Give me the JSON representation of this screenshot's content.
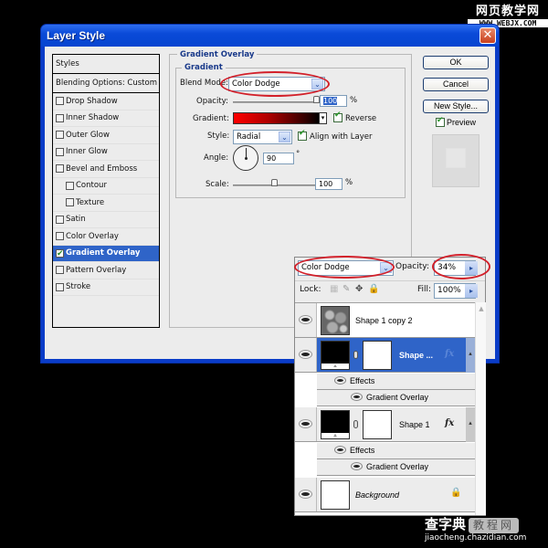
{
  "watermark_top": {
    "cn": "网页教学网",
    "en": "WWW.WEBJX.COM"
  },
  "watermark_bottom": {
    "cn": "查字典",
    "cn_box": "教程网",
    "en": "jiaocheng.chazidian.com"
  },
  "dialog": {
    "title": "Layer Style",
    "close_label": "✕",
    "styles_list": {
      "header": "Styles",
      "blending": "Blending Options: Custom",
      "items": [
        {
          "label": "Drop Shadow",
          "checked": false,
          "indent": false,
          "active": false
        },
        {
          "label": "Inner Shadow",
          "checked": false,
          "indent": false,
          "active": false
        },
        {
          "label": "Outer Glow",
          "checked": false,
          "indent": false,
          "active": false
        },
        {
          "label": "Inner Glow",
          "checked": false,
          "indent": false,
          "active": false
        },
        {
          "label": "Bevel and Emboss",
          "checked": false,
          "indent": false,
          "active": false
        },
        {
          "label": "Contour",
          "checked": false,
          "indent": true,
          "active": false
        },
        {
          "label": "Texture",
          "checked": false,
          "indent": true,
          "active": false
        },
        {
          "label": "Satin",
          "checked": false,
          "indent": false,
          "active": false
        },
        {
          "label": "Color Overlay",
          "checked": false,
          "indent": false,
          "active": false
        },
        {
          "label": "Gradient Overlay",
          "checked": true,
          "indent": false,
          "active": true
        },
        {
          "label": "Pattern Overlay",
          "checked": false,
          "indent": false,
          "active": false
        },
        {
          "label": "Stroke",
          "checked": false,
          "indent": false,
          "active": false
        }
      ]
    },
    "gradient_overlay": {
      "section_title": "Gradient Overlay",
      "group_title": "Gradient",
      "blend_mode_label": "Blend Mode:",
      "blend_mode_value": "Color Dodge",
      "opacity_label": "Opacity:",
      "opacity_value": "100",
      "opacity_unit": "%",
      "opacity_fraction": 1.0,
      "gradient_label": "Gradient:",
      "gradient_colors": [
        "#ff0000",
        "#000000"
      ],
      "reverse_label": "Reverse",
      "reverse_checked": true,
      "style_label": "Style:",
      "style_value": "Radial",
      "align_label": "Align with Layer",
      "align_checked": true,
      "angle_label": "Angle:",
      "angle_value": "90",
      "angle_unit": "°",
      "scale_label": "Scale:",
      "scale_value": "100",
      "scale_unit": "%",
      "scale_fraction": 0.5
    },
    "buttons": {
      "ok": "OK",
      "cancel": "Cancel",
      "new_style": "New Style..."
    },
    "preview_label": "Preview",
    "preview_checked": true
  },
  "layers_panel": {
    "blend_mode": "Color Dodge",
    "opacity_label": "Opacity:",
    "opacity_value": "34%",
    "lock_label": "Lock:",
    "fill_label": "Fill:",
    "fill_value": "100%",
    "layers": [
      {
        "name": "Shape 1 copy 2",
        "selected": false
      },
      {
        "name": "Shape ...",
        "selected": true,
        "effects_label": "Effects",
        "effect": "Gradient Overlay"
      },
      {
        "name": "Shape 1",
        "selected": false,
        "effects_label": "Effects",
        "effect": "Gradient Overlay"
      },
      {
        "name": "Background",
        "selected": false,
        "locked": true
      }
    ]
  },
  "annotation_color": "#d2202a"
}
